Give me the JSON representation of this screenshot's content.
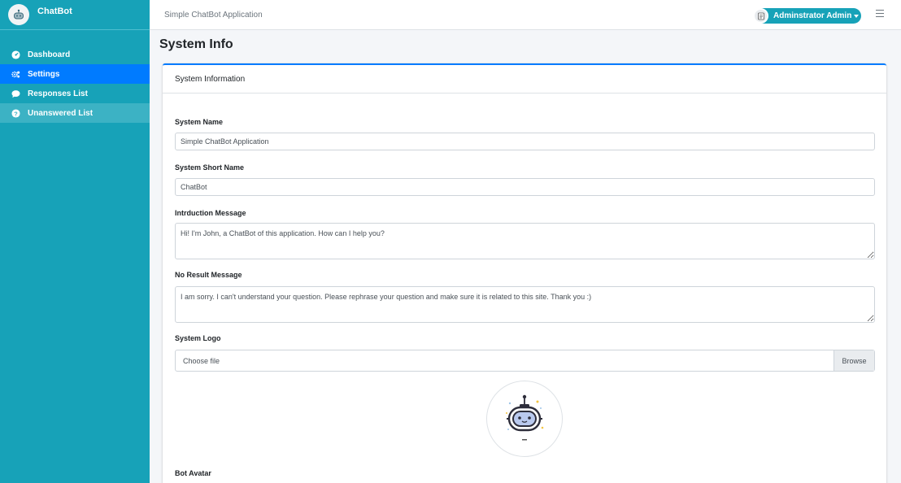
{
  "brand": {
    "name": "ChatBot"
  },
  "sidebar": {
    "items": [
      {
        "label": "Dashboard",
        "icon": "dashboard-icon"
      },
      {
        "label": "Settings",
        "icon": "cogs-icon"
      },
      {
        "label": "Responses List",
        "icon": "comment-icon"
      },
      {
        "label": "Unanswered List",
        "icon": "question-circle-icon"
      }
    ]
  },
  "topbar": {
    "title": "Simple ChatBot Application",
    "user_name": "Adminstrator Admin"
  },
  "page": {
    "title": "System Info"
  },
  "card": {
    "header": "System Information",
    "fields": {
      "system_name": {
        "label": "System Name",
        "value": "Simple ChatBot Application"
      },
      "system_short_name": {
        "label": "System Short Name",
        "value": "ChatBot"
      },
      "intro_message": {
        "label": "Intrduction Message",
        "value": "Hi! I'm John, a ChatBot of this application. How can I help you?"
      },
      "no_result_message": {
        "label": "No Result Message",
        "value": "I am sorry. I can't understand your question. Please rephrase your question and make sure it is related to this site. Thank you :)"
      },
      "system_logo": {
        "label": "System Logo",
        "placeholder": "Choose file",
        "browse_label": "Browse"
      },
      "bot_avatar": {
        "label": "Bot Avatar"
      }
    }
  },
  "colors": {
    "sidebar": "#17a2b8",
    "active": "#007bff",
    "accent_border": "#007bff"
  }
}
